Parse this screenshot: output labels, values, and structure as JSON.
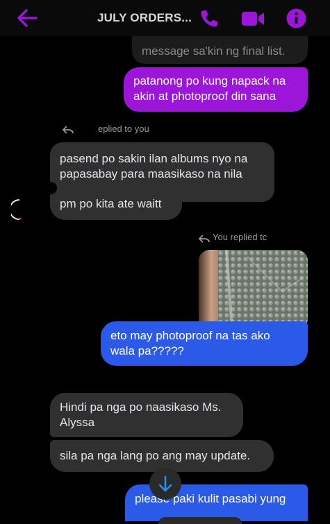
{
  "header": {
    "title": "JULY ORDERS...",
    "icons": [
      "back-arrow-icon",
      "phone-icon",
      "video-call-icon",
      "info-icon"
    ],
    "accent": "#9b16d9"
  },
  "messages": [
    {
      "text": "message sa'kin ng final list.",
      "side": "out",
      "style": "faded"
    },
    {
      "text": "patanong po kung napack na akin at photoproof din sana",
      "lines": [
        "patanong po kung napack na",
        "akin at photoproof din sana"
      ],
      "side": "out",
      "color": "#9b16d9"
    },
    {
      "reply_label": "eplied to you"
    },
    {
      "lines": [
        "pasend po sakin ilan albums nyo na",
        "papasabay para maasikaso na nila"
      ],
      "side": "in"
    },
    {
      "text": "pm po kita ate waitt",
      "side": "in"
    },
    {
      "reply_label": "You replied tc"
    },
    {
      "image": "bubble-wrap-photo",
      "side": "out"
    },
    {
      "lines": [
        "eto may photoproof na tas ako",
        "wala pa?????"
      ],
      "side": "out",
      "color": "#2c5ae8"
    },
    {
      "lines": [
        "Hindi pa nga po naasikaso Ms.",
        "Alyssa"
      ],
      "side": "in"
    },
    {
      "text": "sila pa nga lang po ang may update.",
      "side": "in"
    },
    {
      "text": "please paki kulit pasabi yung",
      "side": "out",
      "color": "#2c5ae8"
    }
  ],
  "controls": {
    "scroll_down_icon": "arrow-down-icon"
  }
}
